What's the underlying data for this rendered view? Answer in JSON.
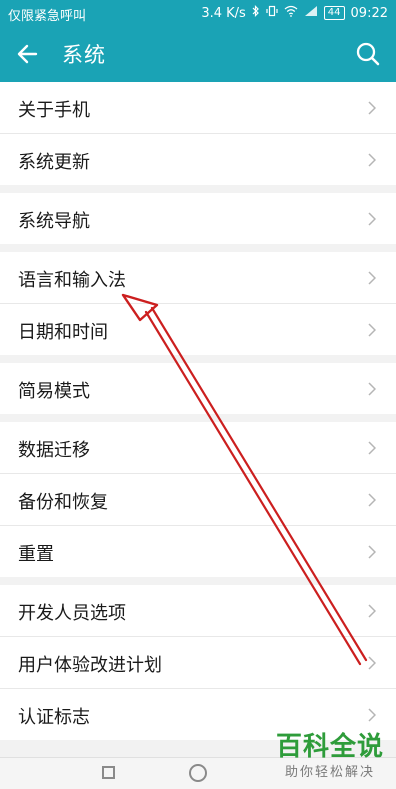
{
  "status_bar": {
    "carrier": "仅限紧急呼叫",
    "speed": "3.4 K/s",
    "battery": "44",
    "time": "09:22"
  },
  "header": {
    "title": "系统",
    "back_icon": "arrow-left-icon",
    "search_icon": "search-icon"
  },
  "groups": [
    {
      "items": [
        {
          "label": "关于手机"
        },
        {
          "label": "系统更新"
        }
      ]
    },
    {
      "items": [
        {
          "label": "系统导航"
        }
      ]
    },
    {
      "items": [
        {
          "label": "语言和输入法"
        },
        {
          "label": "日期和时间"
        }
      ]
    },
    {
      "items": [
        {
          "label": "简易模式"
        }
      ]
    },
    {
      "items": [
        {
          "label": "数据迁移"
        },
        {
          "label": "备份和恢复"
        },
        {
          "label": "重置"
        }
      ]
    },
    {
      "items": [
        {
          "label": "开发人员选项"
        },
        {
          "label": "用户体验改进计划"
        },
        {
          "label": "认证标志"
        }
      ]
    }
  ],
  "watermark": {
    "title": "百科全说",
    "subtitle": "助你轻松解决"
  },
  "colors": {
    "accent": "#1aa3b5",
    "annotation_arrow": "#cc1f1f",
    "watermark_green": "#2e9c3a"
  }
}
